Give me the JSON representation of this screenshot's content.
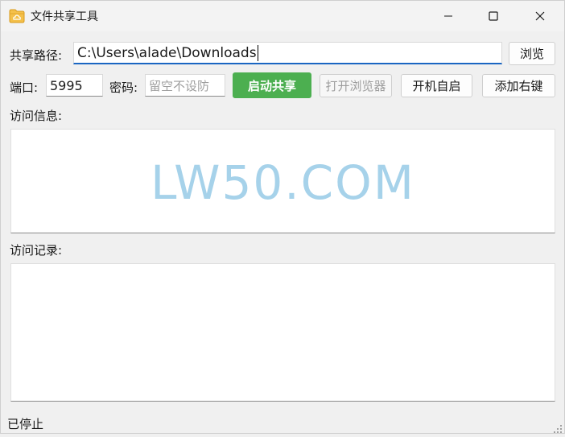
{
  "window": {
    "title": "文件共享工具",
    "controls": [
      "minimize",
      "maximize",
      "close"
    ]
  },
  "path_row": {
    "label": "共享路径:",
    "value": "C:\\Users\\alade\\Downloads",
    "browse_label": "浏览"
  },
  "settings_row": {
    "port_label": "端口:",
    "port_value": "5995",
    "password_label": "密码:",
    "password_placeholder": "留空不设防",
    "start_label": "启动共享",
    "open_browser_label": "打开浏览器",
    "autostart_label": "开机自启",
    "context_menu_label": "添加右键"
  },
  "access_info": {
    "label": "访问信息:",
    "watermark": "LW50.COM"
  },
  "access_log": {
    "label": "访问记录:"
  },
  "status": {
    "text": "已停止"
  },
  "colors": {
    "accent_green": "#4caf50",
    "focus_blue": "#1a66c2",
    "watermark_blue": "#a6d2ea",
    "folder_icon": "#f4c04a"
  },
  "icons": [
    "folder-icon",
    "minimize-icon",
    "maximize-icon",
    "close-icon",
    "resize-grip-icon"
  ]
}
